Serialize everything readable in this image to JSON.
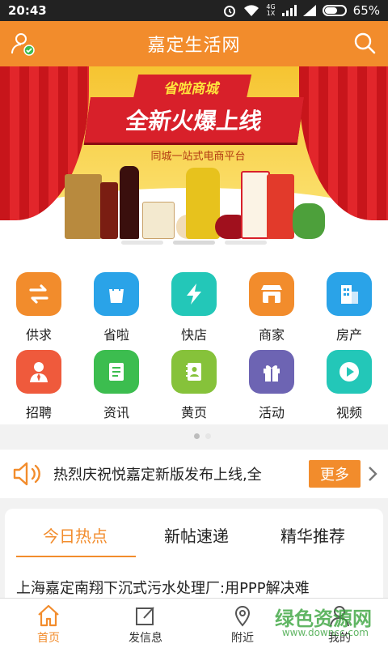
{
  "status_bar": {
    "time": "20:43",
    "network": "4G",
    "network_sub": "1X",
    "battery": "65%",
    "battery_level": 0.65
  },
  "header": {
    "title": "嘉定生活网",
    "left_icon": "user-check-icon",
    "right_icon": "search-icon"
  },
  "banner": {
    "tag": "省啦商城",
    "headline": "全新火爆上线",
    "subtitle": "同城一站式电商平台",
    "slide_count": 3,
    "active_slide": 1
  },
  "grid": {
    "items": [
      {
        "label": "供求",
        "icon": "swap-arrows-icon",
        "color": "#f28c2c"
      },
      {
        "label": "省啦",
        "icon": "shopping-bag-icon",
        "color": "#2aa3e8"
      },
      {
        "label": "快店",
        "icon": "lightning-icon",
        "color": "#23c7b8"
      },
      {
        "label": "商家",
        "icon": "storefront-icon",
        "color": "#f28c2c"
      },
      {
        "label": "房产",
        "icon": "building-icon",
        "color": "#2aa3e8"
      },
      {
        "label": "招聘",
        "icon": "person-tie-icon",
        "color": "#ef5a3c"
      },
      {
        "label": "资讯",
        "icon": "document-icon",
        "color": "#3cbd4f"
      },
      {
        "label": "黄页",
        "icon": "address-book-icon",
        "color": "#86c23a"
      },
      {
        "label": "活动",
        "icon": "gift-icon",
        "color": "#6d64b3"
      },
      {
        "label": "视频",
        "icon": "play-icon",
        "color": "#23c7b8"
      }
    ],
    "page_count": 2,
    "active_page": 0
  },
  "notice": {
    "text": "热烈庆祝悦嘉定新版发布上线,全",
    "more_label": "更多",
    "icon": "speaker-icon"
  },
  "tabs": {
    "items": [
      {
        "label": "今日热点",
        "active": true
      },
      {
        "label": "新帖速递",
        "active": false
      },
      {
        "label": "精华推荐",
        "active": false
      }
    ]
  },
  "headline": {
    "text": "上海嘉定南翔下沉式污水处理厂:用PPP解决难"
  },
  "bottom_nav": {
    "items": [
      {
        "label": "首页",
        "icon": "home-icon",
        "active": true
      },
      {
        "label": "发信息",
        "icon": "edit-icon",
        "active": false
      },
      {
        "label": "附近",
        "icon": "location-pin-icon",
        "active": false
      },
      {
        "label": "我的",
        "icon": "profile-icon",
        "active": false
      }
    ]
  },
  "watermark": {
    "text": "绿色资源网",
    "url": "www.downcc.com"
  },
  "colors": {
    "accent": "#f28c2c",
    "banner_red": "#d8202a",
    "banner_yellow": "#f6c431"
  }
}
